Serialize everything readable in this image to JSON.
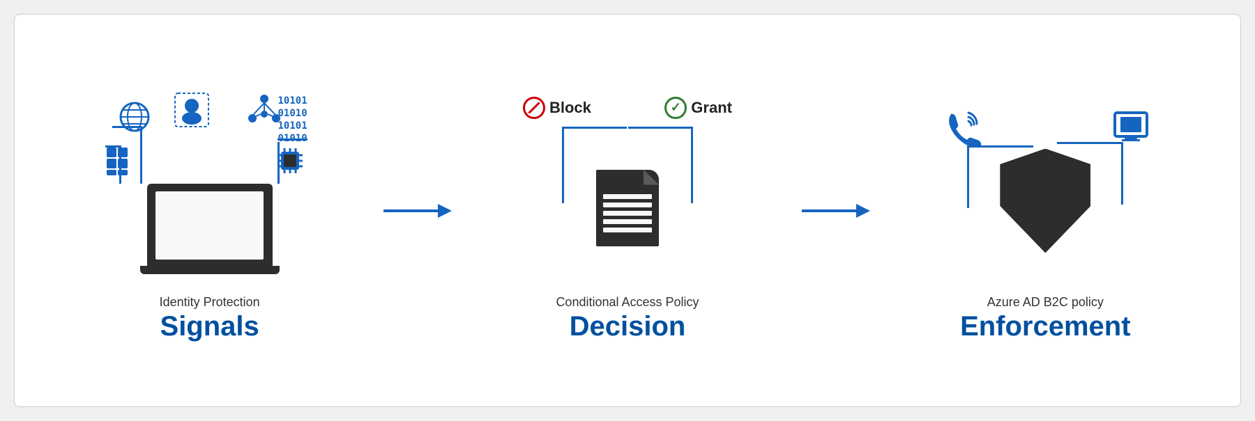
{
  "diagram": {
    "background_color": "#ffffff",
    "border_color": "#cccccc"
  },
  "signals": {
    "subtitle": "Identity Protection",
    "title": "Signals"
  },
  "decision": {
    "subtitle": "Conditional Access Policy",
    "title": "Decision",
    "block_label": "Block",
    "grant_label": "Grant"
  },
  "enforcement": {
    "subtitle": "Azure AD B2C policy",
    "title": "Enforcement"
  },
  "arrows": {
    "color": "#1565c0"
  }
}
